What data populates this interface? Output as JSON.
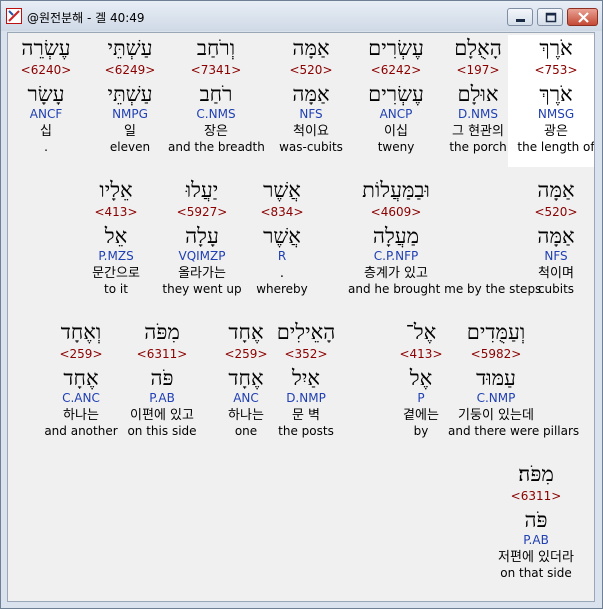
{
  "window": {
    "title": "@원전분해 - 겔 40:49"
  },
  "rows": [
    [
      {
        "hebrew": "אֹרֶךְ",
        "strong": "<753>",
        "lemma": "אֹרֶךְ",
        "parse": "NMSG",
        "korean": "광은",
        "english": "the length of",
        "selected": true
      },
      {
        "hebrew": "הָאֻלָם",
        "strong": "<197>",
        "lemma": "אוּלָם",
        "parse": "D.NMS",
        "korean": "그 현관의",
        "english": "the porch"
      },
      {
        "hebrew": "עֶשְׂרִים",
        "strong": "<6242>",
        "lemma": "עֶשְׂרִים",
        "parse": "ANCP",
        "korean": "이십",
        "english": "tweny"
      },
      {
        "hebrew": "אַמָּה",
        "strong": "<520>",
        "lemma": "אַמָּה",
        "parse": "NFS",
        "korean": "척이요",
        "english": "was-cubits"
      },
      {
        "hebrew": "וְרֹחַב",
        "strong": "<7341>",
        "lemma": "רֹחַב",
        "parse": "C.NMS",
        "korean": "장은",
        "english": "and the breadth"
      },
      {
        "hebrew": "עַשְׁתֵּי",
        "strong": "<6249>",
        "lemma": "עַשְׁתֵּי",
        "parse": "NMPG",
        "korean": "일",
        "english": "eleven"
      },
      {
        "hebrew": "עֶשְׂרֵה",
        "strong": "<6240>",
        "lemma": "עָשָׂר",
        "parse": "ANCF",
        "korean": "십",
        "english": "."
      }
    ],
    [
      {
        "hebrew": "אַמָּה",
        "strong": "<520>",
        "lemma": "אַמָּה",
        "parse": "NFS",
        "korean": "척이며",
        "english": "cubits"
      },
      {
        "hebrew": "וּבַמַּעֲלוֹת",
        "strong": "<4609>",
        "lemma": "מַעֲלָה",
        "parse": "C.P.NFP",
        "korean": "층계가 있고",
        "english": "and he brought me by the steps"
      },
      {
        "hebrew": "אֲשֶׁר",
        "strong": "<834>",
        "lemma": "אֲשֶׁר",
        "parse": "R",
        "korean": ".",
        "english": "whereby"
      },
      {
        "hebrew": "יַעֲלוּ",
        "strong": "<5927>",
        "lemma": "עָלָה",
        "parse": "VQIMZP",
        "korean": "올라가는",
        "english": "they went up"
      },
      {
        "hebrew": "אֵלָיו",
        "strong": "<413>",
        "lemma": "אֵל",
        "parse": "P.MZS",
        "korean": "문간으로",
        "english": "to it"
      }
    ],
    [
      {
        "hebrew": "וְעַמֻּדִים",
        "strong": "<5982>",
        "lemma": "עַמּוּד",
        "parse": "C.NMP",
        "korean": "기둥이 있는데",
        "english": "and there were pillars"
      },
      {
        "hebrew": "אֶל־",
        "strong": "<413>",
        "lemma": "אֶל",
        "parse": "P",
        "korean": "곁에는",
        "english": "by"
      },
      {
        "hebrew": "הָאֵילִים",
        "strong": "<352>",
        "lemma": "אַיִל",
        "parse": "D.NMP",
        "korean": "문 벽",
        "english": "the posts"
      },
      {
        "hebrew": "אֶחָד",
        "strong": "<259>",
        "lemma": "אֶחָד",
        "parse": "ANC",
        "korean": "하나는",
        "english": "one"
      },
      {
        "hebrew": "מִפֹּה",
        "strong": "<6311>",
        "lemma": "פֹּה",
        "parse": "P.AB",
        "korean": "이편에 있고",
        "english": "on this side"
      },
      {
        "hebrew": "וְאֶחָד",
        "strong": "<259>",
        "lemma": "אֶחָד",
        "parse": "C.ANC",
        "korean": "하나는",
        "english": "and another"
      }
    ],
    [
      {
        "hebrew": "מִפֹּה׃",
        "strong": "<6311>",
        "lemma": "פֹּה",
        "parse": "P.AB",
        "korean": "저편에 있더라",
        "english": "on that side"
      }
    ]
  ]
}
